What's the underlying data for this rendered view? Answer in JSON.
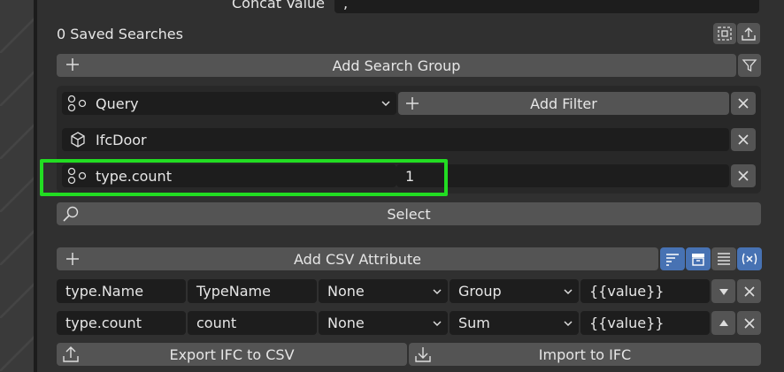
{
  "concat": {
    "label": "Concat Value",
    "value": ","
  },
  "saved_searches": {
    "label": "0 Saved Searches"
  },
  "search_group": {
    "add_label": "Add Search Group"
  },
  "query": {
    "mode_label": "Query",
    "add_filter_label": "Add Filter",
    "entity_value": "IfcDoor",
    "key_value": "type.count",
    "count_value": "1"
  },
  "select_label": "Select",
  "csv": {
    "add_label": "Add CSV Attribute",
    "rows": [
      {
        "attribute": "type.Name",
        "header": "TypeName",
        "sort": "None",
        "aggregate": "Group",
        "format": "{{value}}"
      },
      {
        "attribute": "type.count",
        "header": "count",
        "sort": "None",
        "aggregate": "Sum",
        "format": "{{value}}"
      }
    ]
  },
  "export_label": "Export IFC to CSV",
  "import_label": "Import to IFC",
  "colors": {
    "highlight": "#22dd22",
    "active_toggle": "#4772b3"
  }
}
